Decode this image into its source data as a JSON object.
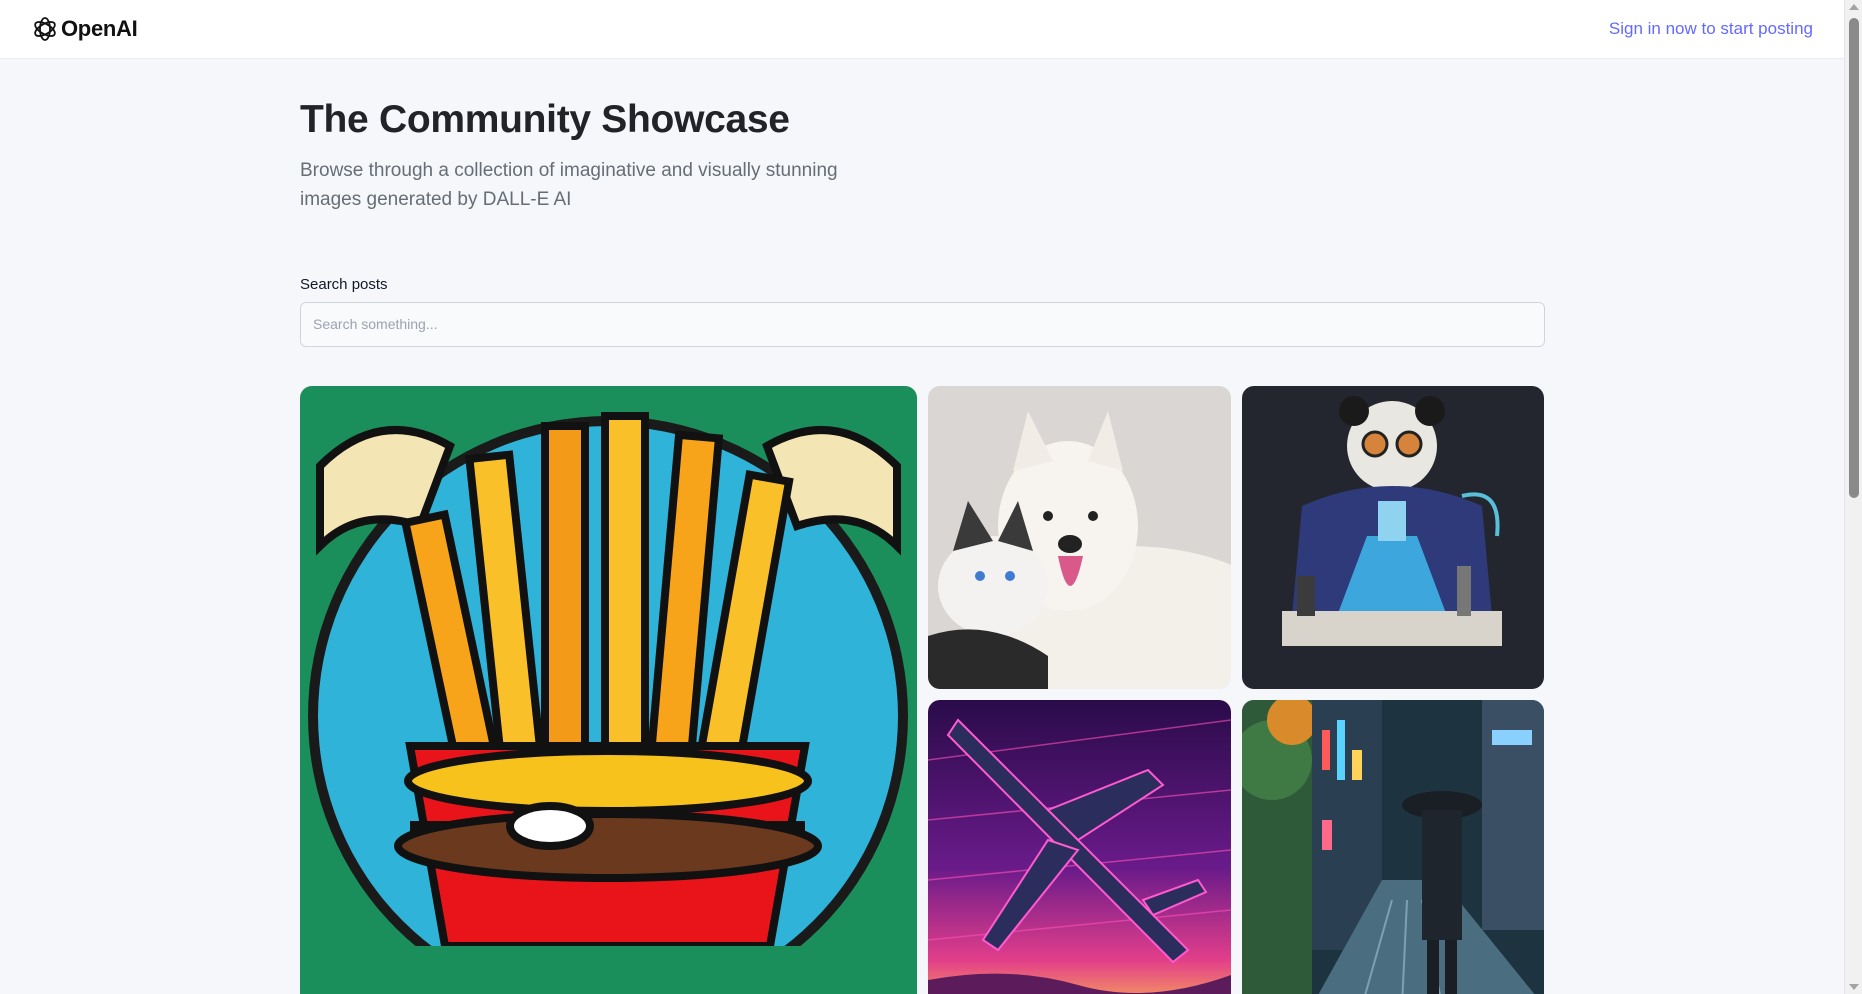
{
  "header": {
    "brand": "OpenAI",
    "signin_link": "Sign in now to start posting"
  },
  "main": {
    "title": "The Community Showcase",
    "subtitle": "Browse through a collection of imaginative and visually stunning images generated by DALL-E AI",
    "search": {
      "label": "Search posts",
      "placeholder": "Search something...",
      "value": ""
    }
  },
  "gallery": [
    {
      "icon": "stained-glass-fries-burger-image"
    },
    {
      "icon": "dog-and-cat-image"
    },
    {
      "icon": "panda-scientist-image"
    },
    {
      "icon": "neon-airplane-image"
    },
    {
      "icon": "rainy-city-street-image"
    }
  ],
  "colors": {
    "accent": "#6469ff",
    "background": "#f6f7fb",
    "title": "#222328",
    "subtitle": "#666e75"
  }
}
